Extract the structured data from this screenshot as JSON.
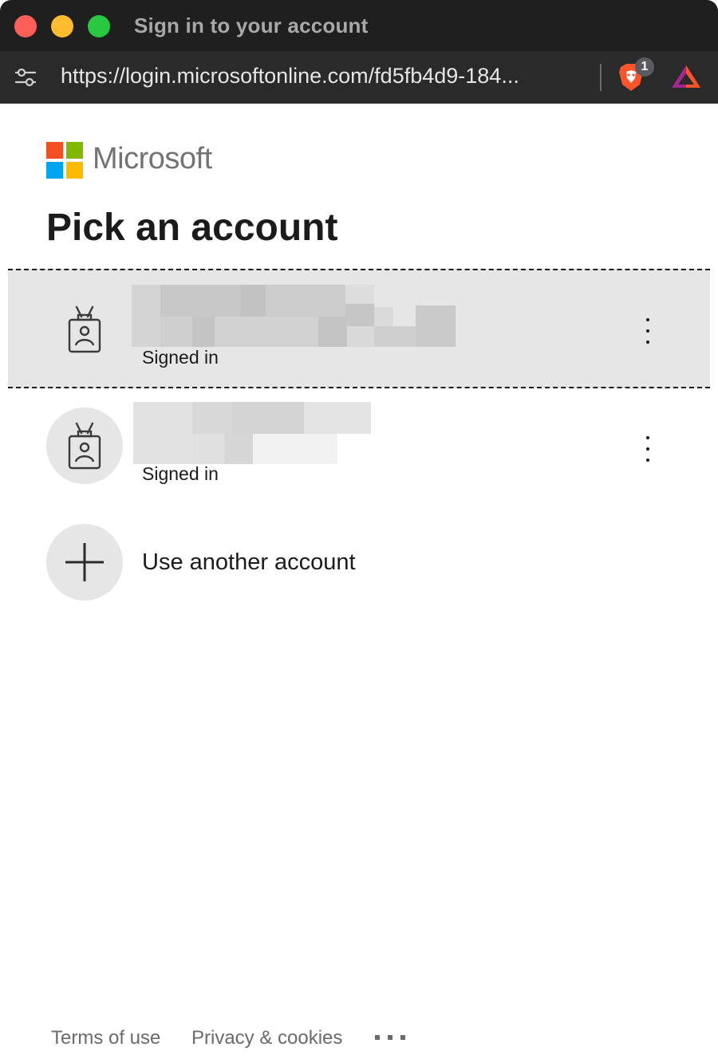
{
  "window": {
    "title": "Sign in to your account",
    "url": "https://login.microsoftonline.com/fd5fb4d9-184...",
    "brave_shield_count": "1"
  },
  "brand": {
    "wordmark": "Microsoft",
    "logo_colors": [
      "#f25022",
      "#7fba00",
      "#00a4ef",
      "#ffb900"
    ]
  },
  "page": {
    "title": "Pick an account"
  },
  "accounts": [
    {
      "status": "Signed in",
      "selected": true
    },
    {
      "status": "Signed in",
      "selected": false
    }
  ],
  "add_account": {
    "label": "Use another account"
  },
  "footer": {
    "terms": "Terms of use",
    "privacy": "Privacy & cookies",
    "more": "..."
  }
}
